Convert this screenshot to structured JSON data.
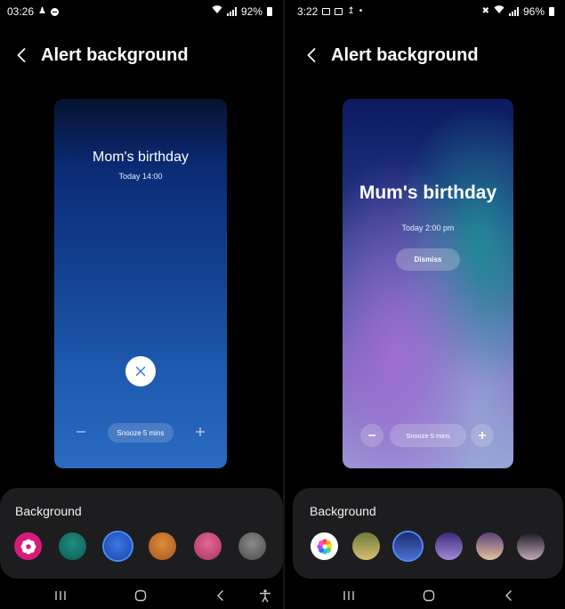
{
  "left_screen": {
    "status": {
      "time": "03:26",
      "battery": "92%"
    },
    "header": {
      "title": "Alert background"
    },
    "preview": {
      "title": "Mom's birthday",
      "subtitle": "Today 14:00",
      "snooze_label": "Snooze 5 mins",
      "minus_icon": "minus-icon",
      "plus_icon": "plus-icon",
      "close_icon": "close-icon"
    },
    "background_panel": {
      "label": "Background",
      "swatches": [
        {
          "name": "gallery",
          "color": "#d81b7a",
          "icon": "flower-icon"
        },
        {
          "name": "teal",
          "color": "#17786c"
        },
        {
          "name": "blue",
          "color": "#2c5ecb",
          "selected": true
        },
        {
          "name": "amber",
          "color": "#c4712e"
        },
        {
          "name": "pink",
          "color": "#c94d78"
        },
        {
          "name": "gray",
          "color": "#6b6b6b"
        }
      ]
    },
    "navbar": [
      "recents-icon",
      "home-icon",
      "back-icon",
      "accessibility-icon"
    ]
  },
  "right_screen": {
    "status": {
      "time": "3:22",
      "battery": "96%"
    },
    "header": {
      "title": "Alert background"
    },
    "preview": {
      "title": "Mum's birthday",
      "subtitle": "Today 2:00 pm",
      "dismiss_label": "Dismiss",
      "snooze_label": "Snooze 5 mins",
      "minus_icon": "minus-icon",
      "plus_icon": "plus-icon"
    },
    "background_panel": {
      "label": "Background",
      "swatches": [
        {
          "name": "gallery",
          "color": "#ffffff",
          "icon": "flower-icon"
        },
        {
          "name": "olive-gold",
          "color": "#a09a58"
        },
        {
          "name": "blue",
          "color": "#2f4fa8",
          "selected": true
        },
        {
          "name": "violet",
          "color": "#7050a8"
        },
        {
          "name": "mauve-peach",
          "color": "#a98a8a"
        },
        {
          "name": "dusk",
          "color": "#7c6e7e"
        }
      ]
    },
    "navbar": [
      "recents-icon",
      "home-icon",
      "back-icon"
    ]
  }
}
